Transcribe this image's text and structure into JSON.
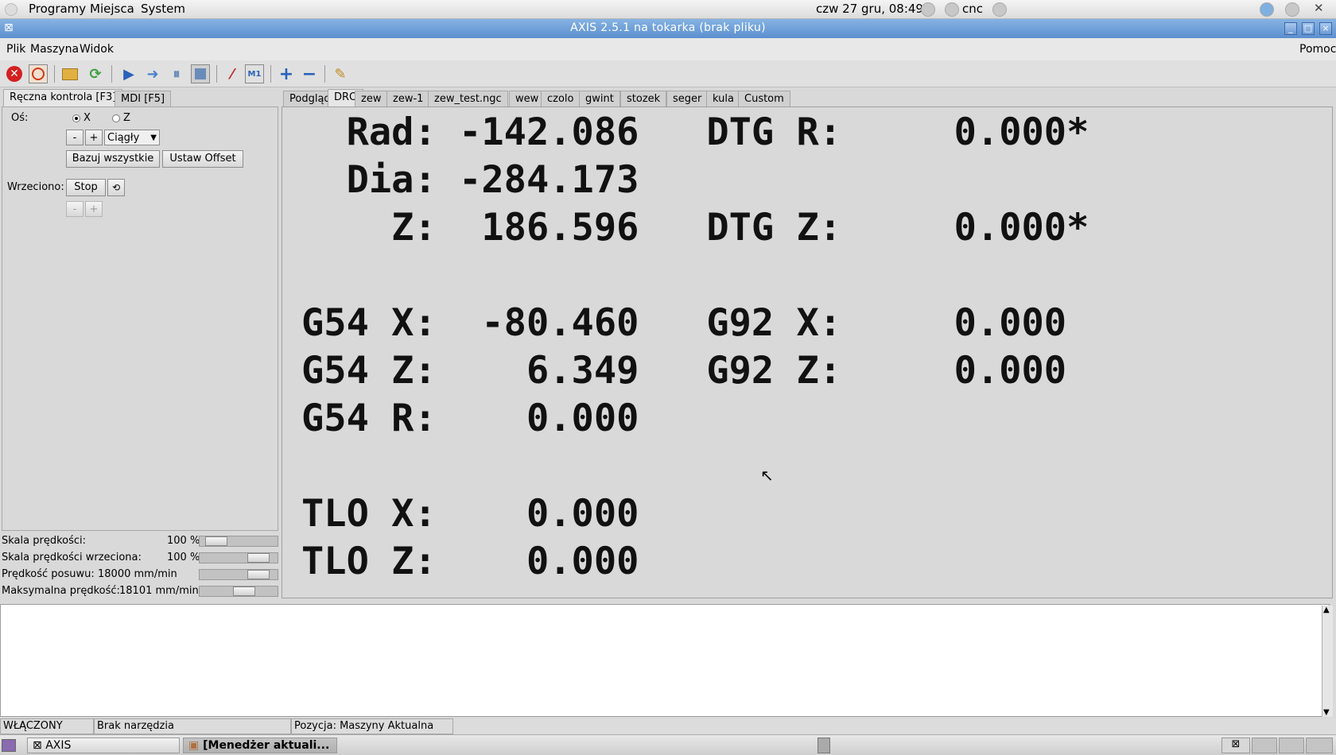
{
  "gnome_panel": {
    "menus": [
      "Programy",
      "Miejsca",
      "System"
    ],
    "clock": "czw 27 gru, 08:49",
    "user": "cnc"
  },
  "window": {
    "title": "AXIS 2.5.1 na tokarka (brak pliku)"
  },
  "menubar": {
    "items": [
      "Plik",
      "Maszyna",
      "Widok"
    ],
    "help": "Pomoc"
  },
  "toolbar": {
    "icons": [
      "estop-icon",
      "power-icon",
      "open-file-icon",
      "reload-icon",
      "run-icon",
      "step-icon",
      "pause-icon",
      "stop-icon",
      "block-delete-icon",
      "optional-stop-icon",
      "zoom-in-icon",
      "zoom-out-icon",
      "clear-plot-icon"
    ]
  },
  "left_panel": {
    "tabs": [
      "Ręczna kontrola [F3]",
      "MDI [F5]"
    ],
    "axis_label": "Oś:",
    "axis_options": [
      "X",
      "Z"
    ],
    "axis_selected": "X",
    "jog_minus": "-",
    "jog_plus": "+",
    "jog_mode": "Ciągły",
    "home_all": "Bazuj wszystkie",
    "set_offset": "Ustaw Offset",
    "spindle_label": "Wrzeciono:",
    "spindle_stop": "Stop",
    "spindle_minus": "-",
    "spindle_plus": "+"
  },
  "sliders": [
    {
      "label": "Skala prędkości:",
      "value": "100 %",
      "level": 0.1
    },
    {
      "label": "Skala prędkości wrzeciona:",
      "value": "100 %",
      "level": 0.85
    },
    {
      "label": "Prędkość posuwu:",
      "value": "18000 mm/min",
      "level": 0.85
    },
    {
      "label": "Maksymalna prędkość:",
      "value": "18101 mm/min",
      "level": 0.6
    }
  ],
  "right_tabs": [
    "Podgląd",
    "DRO",
    "zew",
    "zew-1",
    "zew_test.ngc",
    "wew",
    "czolo",
    "gwint",
    "stozek",
    "seger",
    "kula",
    "Custom"
  ],
  "right_tab_active": "DRO",
  "dro": {
    "lines": [
      "  Rad: -142.086   DTG R:     0.000*",
      "  Dia: -284.173",
      "    Z:  186.596   DTG Z:     0.000*",
      "",
      "G54 X:  -80.460   G92 X:     0.000",
      "G54 Z:    6.349   G92 Z:     0.000",
      "G54 R:    0.000",
      "",
      "TLO X:    0.000",
      "TLO Z:    0.000"
    ]
  },
  "status_bar": {
    "state": "WŁĄCZONY",
    "tool": "Brak narzędzia",
    "position": "Pozycja: Maszyny Aktualna"
  },
  "taskbar": {
    "tasks": [
      "AXIS",
      "[Menedżer aktuali..."
    ]
  }
}
